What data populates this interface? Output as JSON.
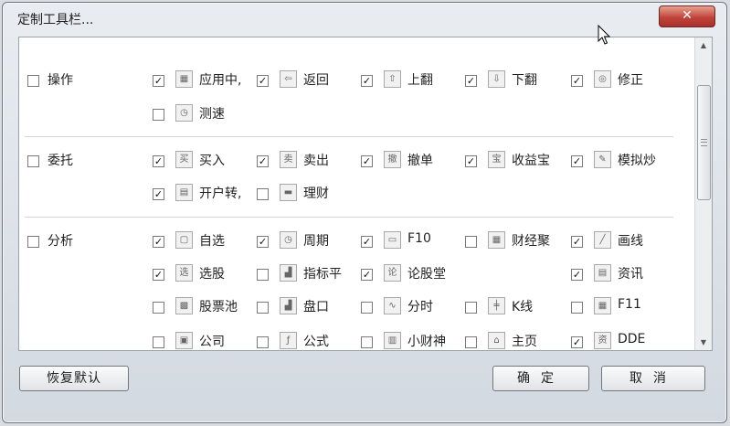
{
  "window": {
    "title": "定制工具栏...",
    "close_label": "✕"
  },
  "groups": [
    {
      "label": "操作",
      "checked": false,
      "items": [
        {
          "label": "应用中,",
          "checked": true,
          "icon": "app-center-icon",
          "glyph": "▦"
        },
        {
          "label": "返回",
          "checked": true,
          "icon": "back-arrow-icon",
          "glyph": "⇦"
        },
        {
          "label": "上翻",
          "checked": true,
          "icon": "page-up-icon",
          "glyph": "⇧"
        },
        {
          "label": "下翻",
          "checked": true,
          "icon": "page-down-icon",
          "glyph": "⇩"
        },
        {
          "label": "修正",
          "checked": true,
          "icon": "correct-icon",
          "glyph": "◎"
        },
        {
          "label": "测速",
          "checked": false,
          "icon": "clock-icon",
          "glyph": "◷"
        }
      ]
    },
    {
      "label": "委托",
      "checked": false,
      "items": [
        {
          "label": "买入",
          "checked": true,
          "icon": "buy-icon",
          "glyph": "买"
        },
        {
          "label": "卖出",
          "checked": true,
          "icon": "sell-icon",
          "glyph": "卖"
        },
        {
          "label": "撤单",
          "checked": true,
          "icon": "cancel-order-icon",
          "glyph": "撤"
        },
        {
          "label": "收益宝",
          "checked": true,
          "icon": "earnings-icon",
          "glyph": "宝"
        },
        {
          "label": "模拟炒",
          "checked": true,
          "icon": "simulate-icon",
          "glyph": "✎"
        },
        {
          "label": "开户转,",
          "checked": true,
          "icon": "account-icon",
          "glyph": "▤"
        },
        {
          "label": "理财",
          "checked": false,
          "icon": "finance-icon",
          "glyph": "▬"
        }
      ]
    },
    {
      "label": "分析",
      "checked": false,
      "items": [
        {
          "label": "自选",
          "checked": true,
          "icon": "watchlist-icon",
          "glyph": "▢"
        },
        {
          "label": "周期",
          "checked": true,
          "icon": "period-icon",
          "glyph": "◷"
        },
        {
          "label": "F10",
          "checked": true,
          "icon": "f10-icon",
          "glyph": "▭"
        },
        {
          "label": "财经聚",
          "checked": false,
          "icon": "calendar-icon",
          "glyph": "▦"
        },
        {
          "label": "画线",
          "checked": true,
          "icon": "draw-line-icon",
          "glyph": "╱"
        },
        {
          "label": "选股",
          "checked": true,
          "icon": "stock-pick-icon",
          "glyph": "选"
        },
        {
          "label": "指标平",
          "checked": false,
          "icon": "indicator-icon",
          "glyph": "▟"
        },
        {
          "label": "论股堂",
          "checked": true,
          "icon": "forum-icon",
          "glyph": "论"
        },
        {
          "label": "资讯",
          "checked": true,
          "icon": "news-icon",
          "glyph": "▤"
        },
        {
          "label": "股票池",
          "checked": false,
          "icon": "stock-pool-icon",
          "glyph": "▩"
        },
        {
          "label": "盘口",
          "checked": false,
          "icon": "order-book-icon",
          "glyph": "▟"
        },
        {
          "label": "分时",
          "checked": false,
          "icon": "intraday-icon",
          "glyph": "∿"
        },
        {
          "label": "K线",
          "checked": false,
          "icon": "candlestick-icon",
          "glyph": "╪"
        },
        {
          "label": "F11",
          "checked": false,
          "icon": "f11-icon",
          "glyph": "▦"
        },
        {
          "label": "公司",
          "checked": false,
          "icon": "company-icon",
          "glyph": "▣"
        },
        {
          "label": "公式",
          "checked": false,
          "icon": "formula-icon",
          "glyph": "ƒ"
        },
        {
          "label": "小财神",
          "checked": false,
          "icon": "wealth-god-icon",
          "glyph": "▥"
        },
        {
          "label": "主页",
          "checked": false,
          "icon": "home-icon",
          "glyph": "⌂"
        },
        {
          "label": "DDE",
          "checked": true,
          "icon": "dde-icon",
          "glyph": "资"
        }
      ]
    }
  ],
  "buttons": {
    "restore_default": "恢复默认",
    "ok": "确定",
    "cancel": "取消"
  },
  "scrollbar": {
    "up_arrow": "▲",
    "down_arrow": "▼"
  }
}
